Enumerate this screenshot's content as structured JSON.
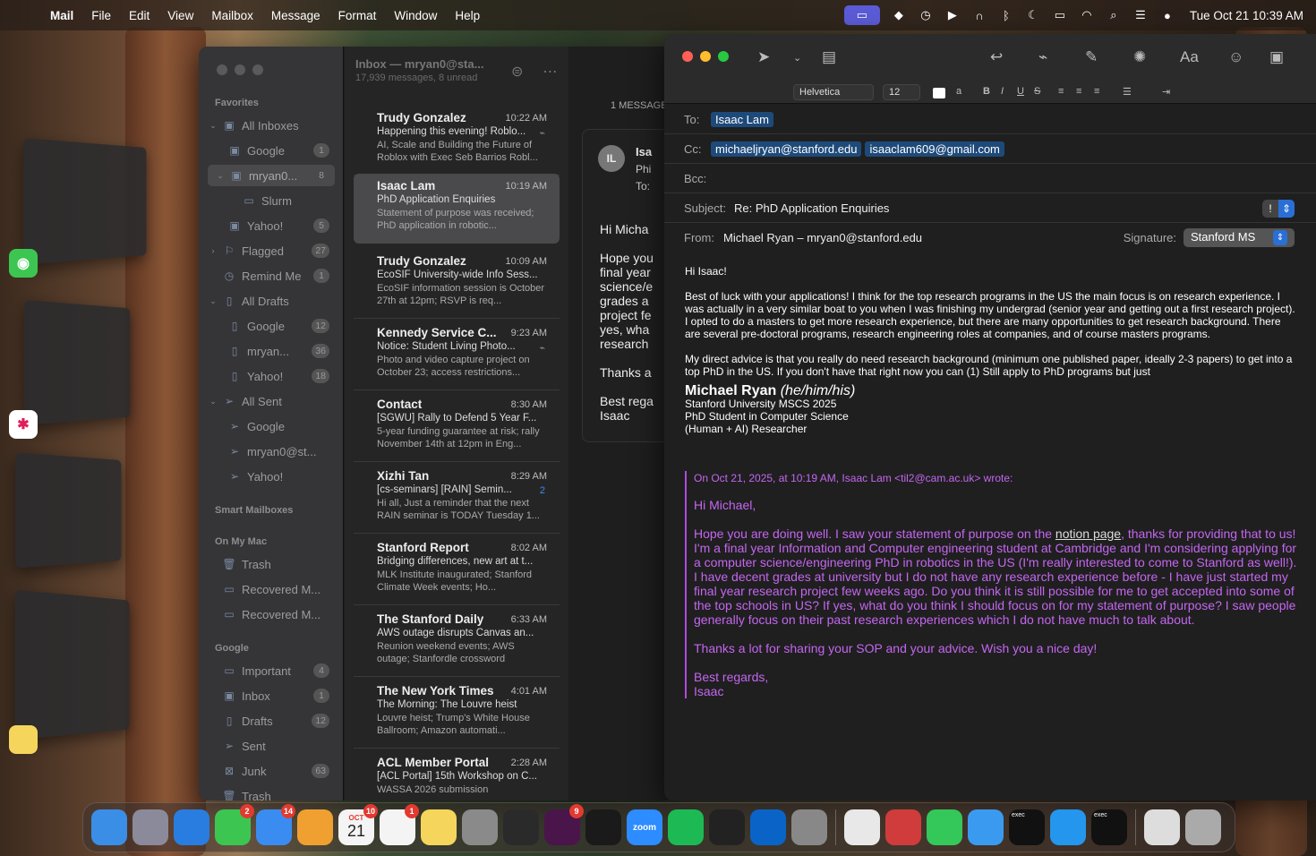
{
  "menubar": {
    "app": "Mail",
    "items": [
      "File",
      "Edit",
      "View",
      "Mailbox",
      "Message",
      "Format",
      "Window",
      "Help"
    ],
    "datetime": "Tue Oct 21  10:39 AM"
  },
  "sidebar": {
    "favorites_title": "Favorites",
    "smart_title": "Smart Mailboxes",
    "onmymac_title": "On My Mac",
    "google_title": "Google",
    "items": [
      {
        "label": "All Inboxes",
        "count": ""
      },
      {
        "label": "Google",
        "count": "1"
      },
      {
        "label": "mryan0...",
        "count": "8"
      },
      {
        "label": "Slurm",
        "count": ""
      },
      {
        "label": "Yahoo!",
        "count": "5"
      },
      {
        "label": "Flagged",
        "count": "27"
      },
      {
        "label": "Remind Me",
        "count": "1"
      },
      {
        "label": "All Drafts",
        "count": ""
      },
      {
        "label": "Google",
        "count": "12"
      },
      {
        "label": "mryan...",
        "count": "36"
      },
      {
        "label": "Yahoo!",
        "count": "18"
      },
      {
        "label": "All Sent",
        "count": ""
      },
      {
        "label": "Google",
        "count": ""
      },
      {
        "label": "mryan0@st...",
        "count": ""
      },
      {
        "label": "Yahoo!",
        "count": ""
      },
      {
        "label": "Trash",
        "count": ""
      },
      {
        "label": "Recovered M...",
        "count": ""
      },
      {
        "label": "Recovered M...",
        "count": ""
      },
      {
        "label": "Important",
        "count": "4"
      },
      {
        "label": "Inbox",
        "count": "1"
      },
      {
        "label": "Drafts",
        "count": "12"
      },
      {
        "label": "Sent",
        "count": ""
      },
      {
        "label": "Junk",
        "count": "63"
      },
      {
        "label": "Trash",
        "count": ""
      }
    ]
  },
  "msglist": {
    "title": "Inbox — mryan0@sta...",
    "subtitle": "17,939 messages, 8 unread",
    "messages": [
      {
        "from": "Trudy Gonzalez",
        "time": "10:22 AM",
        "subject": "Happening this evening! Roblo...",
        "preview": "AI, Scale and Building the Future of Roblox with Exec Seb Barrios Robl..."
      },
      {
        "from": "Isaac Lam",
        "time": "10:19 AM",
        "subject": "PhD Application Enquiries",
        "preview": "Statement of purpose was received; PhD application in robotic..."
      },
      {
        "from": "Trudy Gonzalez",
        "time": "10:09 AM",
        "subject": "EcoSIF University-wide Info Sess...",
        "preview": "EcoSIF information session is October 27th at 12pm; RSVP is req..."
      },
      {
        "from": "Kennedy Service C...",
        "time": "9:23 AM",
        "subject": "Notice: Student Living Photo...",
        "preview": "Photo and video capture project on October 23; access restrictions..."
      },
      {
        "from": "Contact",
        "time": "8:30 AM",
        "subject": "[SGWU] Rally to Defend 5 Year F...",
        "preview": "5-year funding guarantee at risk; rally November 14th at 12pm in Eng..."
      },
      {
        "from": "Xizhi Tan",
        "time": "8:29 AM",
        "subject": "[cs-seminars] [RAIN] Semin...",
        "preview": "Hi all, Just a reminder that the next RAIN seminar is TODAY Tuesday 1..."
      },
      {
        "from": "Stanford Report",
        "time": "8:02 AM",
        "subject": "Bridging differences, new art at t...",
        "preview": "MLK Institute inaugurated; Stanford Climate Week events; Ho..."
      },
      {
        "from": "The Stanford Daily",
        "time": "6:33 AM",
        "subject": "AWS outage disrupts Canvas an...",
        "preview": "Reunion weekend events; AWS outage; Stanfordle crossword"
      },
      {
        "from": "The New York Times",
        "time": "4:01 AM",
        "subject": "The Morning: The Louvre heist",
        "preview": "Louvre heist; Trump's White House Ballroom; Amazon automati..."
      },
      {
        "from": "ACL Member Portal",
        "time": "2:28 AM",
        "subject": "[ACL Portal] 15th Workshop on C...",
        "preview": "WASSA 2026 submission"
      }
    ],
    "thread_count": "2"
  },
  "reader": {
    "count": "1 MESSAGE",
    "avatar": "IL",
    "from": "Isa",
    "line2": "Phi",
    "line3": "To:",
    "body": [
      "Hi Micha",
      "",
      "Hope you",
      "final year",
      "science/e",
      "grades a",
      "project fe",
      "yes, wha",
      "research",
      "",
      "Thanks a",
      "",
      "Best rega",
      "Isaac"
    ]
  },
  "compose": {
    "font": "Helvetica",
    "size": "12",
    "to_label": "To:",
    "to": "Isaac Lam",
    "cc_label": "Cc:",
    "cc": [
      "michaeljryan@stanford.edu",
      "isaaclam609@gmail.com"
    ],
    "bcc_label": "Bcc:",
    "subject_label": "Subject:",
    "subject": "Re: PhD Application Enquiries",
    "priority": "!",
    "from_label": "From:",
    "from": "Michael Ryan – mryan0@stanford.edu",
    "signature_label": "Signature:",
    "signature": "Stanford MS",
    "greeting": "Hi Isaac!",
    "para1": "Best of luck with your applications!  I think for the top research programs in the US the main focus is on research experience.  I was actually in a very similar boat to you when I was finishing my undergrad (senior year and getting out a first research project).  I opted to do a masters to get more research experience, but there are many opportunities to get research background.  There are several pre-doctoral programs, research engineering roles at companies, and of course masters programs.",
    "para2": "My direct advice is that you really do need research background (minimum one published paper, ideally 2-3 papers) to get into a top PhD in the US.  If you don't have that right now you can (1) Still apply to PhD programs but just",
    "sig_name": "Michael Ryan",
    "sig_pronouns": "(he/him/his)",
    "sig_lines": [
      "Stanford University MSCS 2025",
      "PhD Student in Computer Science",
      "(Human + AI) Researcher"
    ],
    "quote_attrib": "On Oct 21, 2025, at 10:19 AM, Isaac Lam <til2@cam.ac.uk> wrote:",
    "quote_greeting": "Hi Michael,",
    "quote_p1_a": "Hope you are doing well. I saw your statement of purpose on the ",
    "quote_link": "notion page",
    "quote_p1_b": ", thanks for providing that to us! I'm a final year Information and Computer engineering student at Cambridge and I'm considering applying for a computer science/engineering PhD in robotics in the US (I'm really interested to come to Stanford as well!). I have decent grades at university but I do not have any research experience before - I have just started my final year research project few weeks ago. Do you think it is still possible for me to get accepted into some of the top schools in US? If yes, what do you think I should focus on for my statement of purpose? I saw people generally focus on their past research experiences which I do not have much to talk about.",
    "quote_p2": "Thanks a lot for sharing your SOP and your advice. Wish you a nice day!",
    "quote_closing": "Best regards,",
    "quote_name": "Isaac"
  },
  "dock": {
    "apps": [
      {
        "name": "Finder",
        "color": "#3a8ee6",
        "badge": ""
      },
      {
        "name": "Launchpad",
        "color": "#8a8a9a",
        "badge": ""
      },
      {
        "name": "Safari",
        "color": "#2a7de0",
        "badge": ""
      },
      {
        "name": "Messages",
        "color": "#3cc651",
        "badge": "2"
      },
      {
        "name": "Mail",
        "color": "#3b8cf0",
        "badge": "14"
      },
      {
        "name": "Photos",
        "color": "#f0a030",
        "badge": ""
      },
      {
        "name": "Calendar",
        "color": "#f4f4f4",
        "badge": "10"
      },
      {
        "name": "Reminders",
        "color": "#f4f4f4",
        "badge": "1"
      },
      {
        "name": "Notes",
        "color": "#f6d55c",
        "badge": ""
      },
      {
        "name": "System Settings",
        "color": "#8a8a8a",
        "badge": ""
      },
      {
        "name": "ChatGPT",
        "color": "#2a2a2a",
        "badge": ""
      },
      {
        "name": "Slack",
        "color": "#4a154b",
        "badge": "9"
      },
      {
        "name": "Terminal",
        "color": "#1a1a1a",
        "badge": ""
      },
      {
        "name": "Zoom",
        "color": "#2d8cff",
        "badge": ""
      },
      {
        "name": "Spotify",
        "color": "#1db954",
        "badge": ""
      },
      {
        "name": "Cursor",
        "color": "#222",
        "badge": ""
      },
      {
        "name": "Outlook",
        "color": "#0a64c8",
        "badge": ""
      },
      {
        "name": "iPhone Mirroring",
        "color": "#888",
        "badge": ""
      },
      {
        "name": "Chrome",
        "color": "#e8e8e8",
        "badge": ""
      },
      {
        "name": "Zotero",
        "color": "#d03c3c",
        "badge": ""
      },
      {
        "name": "Numbers",
        "color": "#34c759",
        "badge": ""
      },
      {
        "name": "Keynote",
        "color": "#3a9af0",
        "badge": ""
      },
      {
        "name": "exec",
        "color": "#111",
        "badge": ""
      },
      {
        "name": "Docker",
        "color": "#2496ed",
        "badge": ""
      },
      {
        "name": "exec",
        "color": "#111",
        "badge": ""
      },
      {
        "name": "Downloads",
        "color": "#ddd",
        "badge": ""
      },
      {
        "name": "Trash",
        "color": "#aaa",
        "badge": ""
      }
    ],
    "calendar_month": "OCT",
    "calendar_day": "21",
    "zoom_label": "zoom",
    "exec_label": "exec"
  }
}
